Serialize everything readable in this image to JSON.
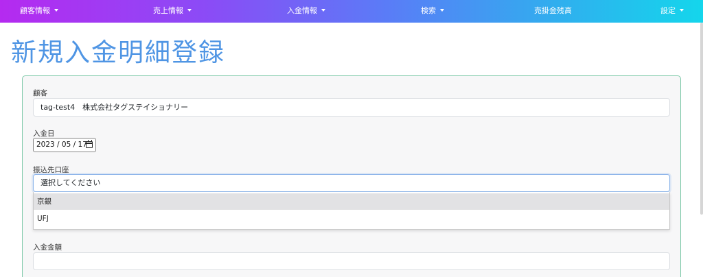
{
  "nav": {
    "items": [
      {
        "label": "顧客情報",
        "has_caret": true
      },
      {
        "label": "売上情報",
        "has_caret": true
      },
      {
        "label": "入金情報",
        "has_caret": true
      },
      {
        "label": "検索",
        "has_caret": true
      },
      {
        "label": "売掛金残高",
        "has_caret": false
      },
      {
        "label": "設定",
        "has_caret": true
      }
    ]
  },
  "page": {
    "title": "新規入金明細登録"
  },
  "form": {
    "customer": {
      "label": "顧客",
      "value": "tag-test4　株式会社タグステイショナリー"
    },
    "deposit_date": {
      "label": "入金日",
      "value": "2023 / 05 / 17"
    },
    "account": {
      "label": "振込先口座",
      "placeholder": "選択してください",
      "options": [
        "京銀",
        "UFJ"
      ]
    },
    "amount": {
      "label": "入金金額",
      "value": ""
    }
  },
  "colors": {
    "nav_gradient_start": "#b52af0",
    "nav_gradient_end": "#14d6ec",
    "title": "#4f95e4",
    "card_border": "#7fc9a9",
    "focus_border": "#8fb6ea"
  }
}
